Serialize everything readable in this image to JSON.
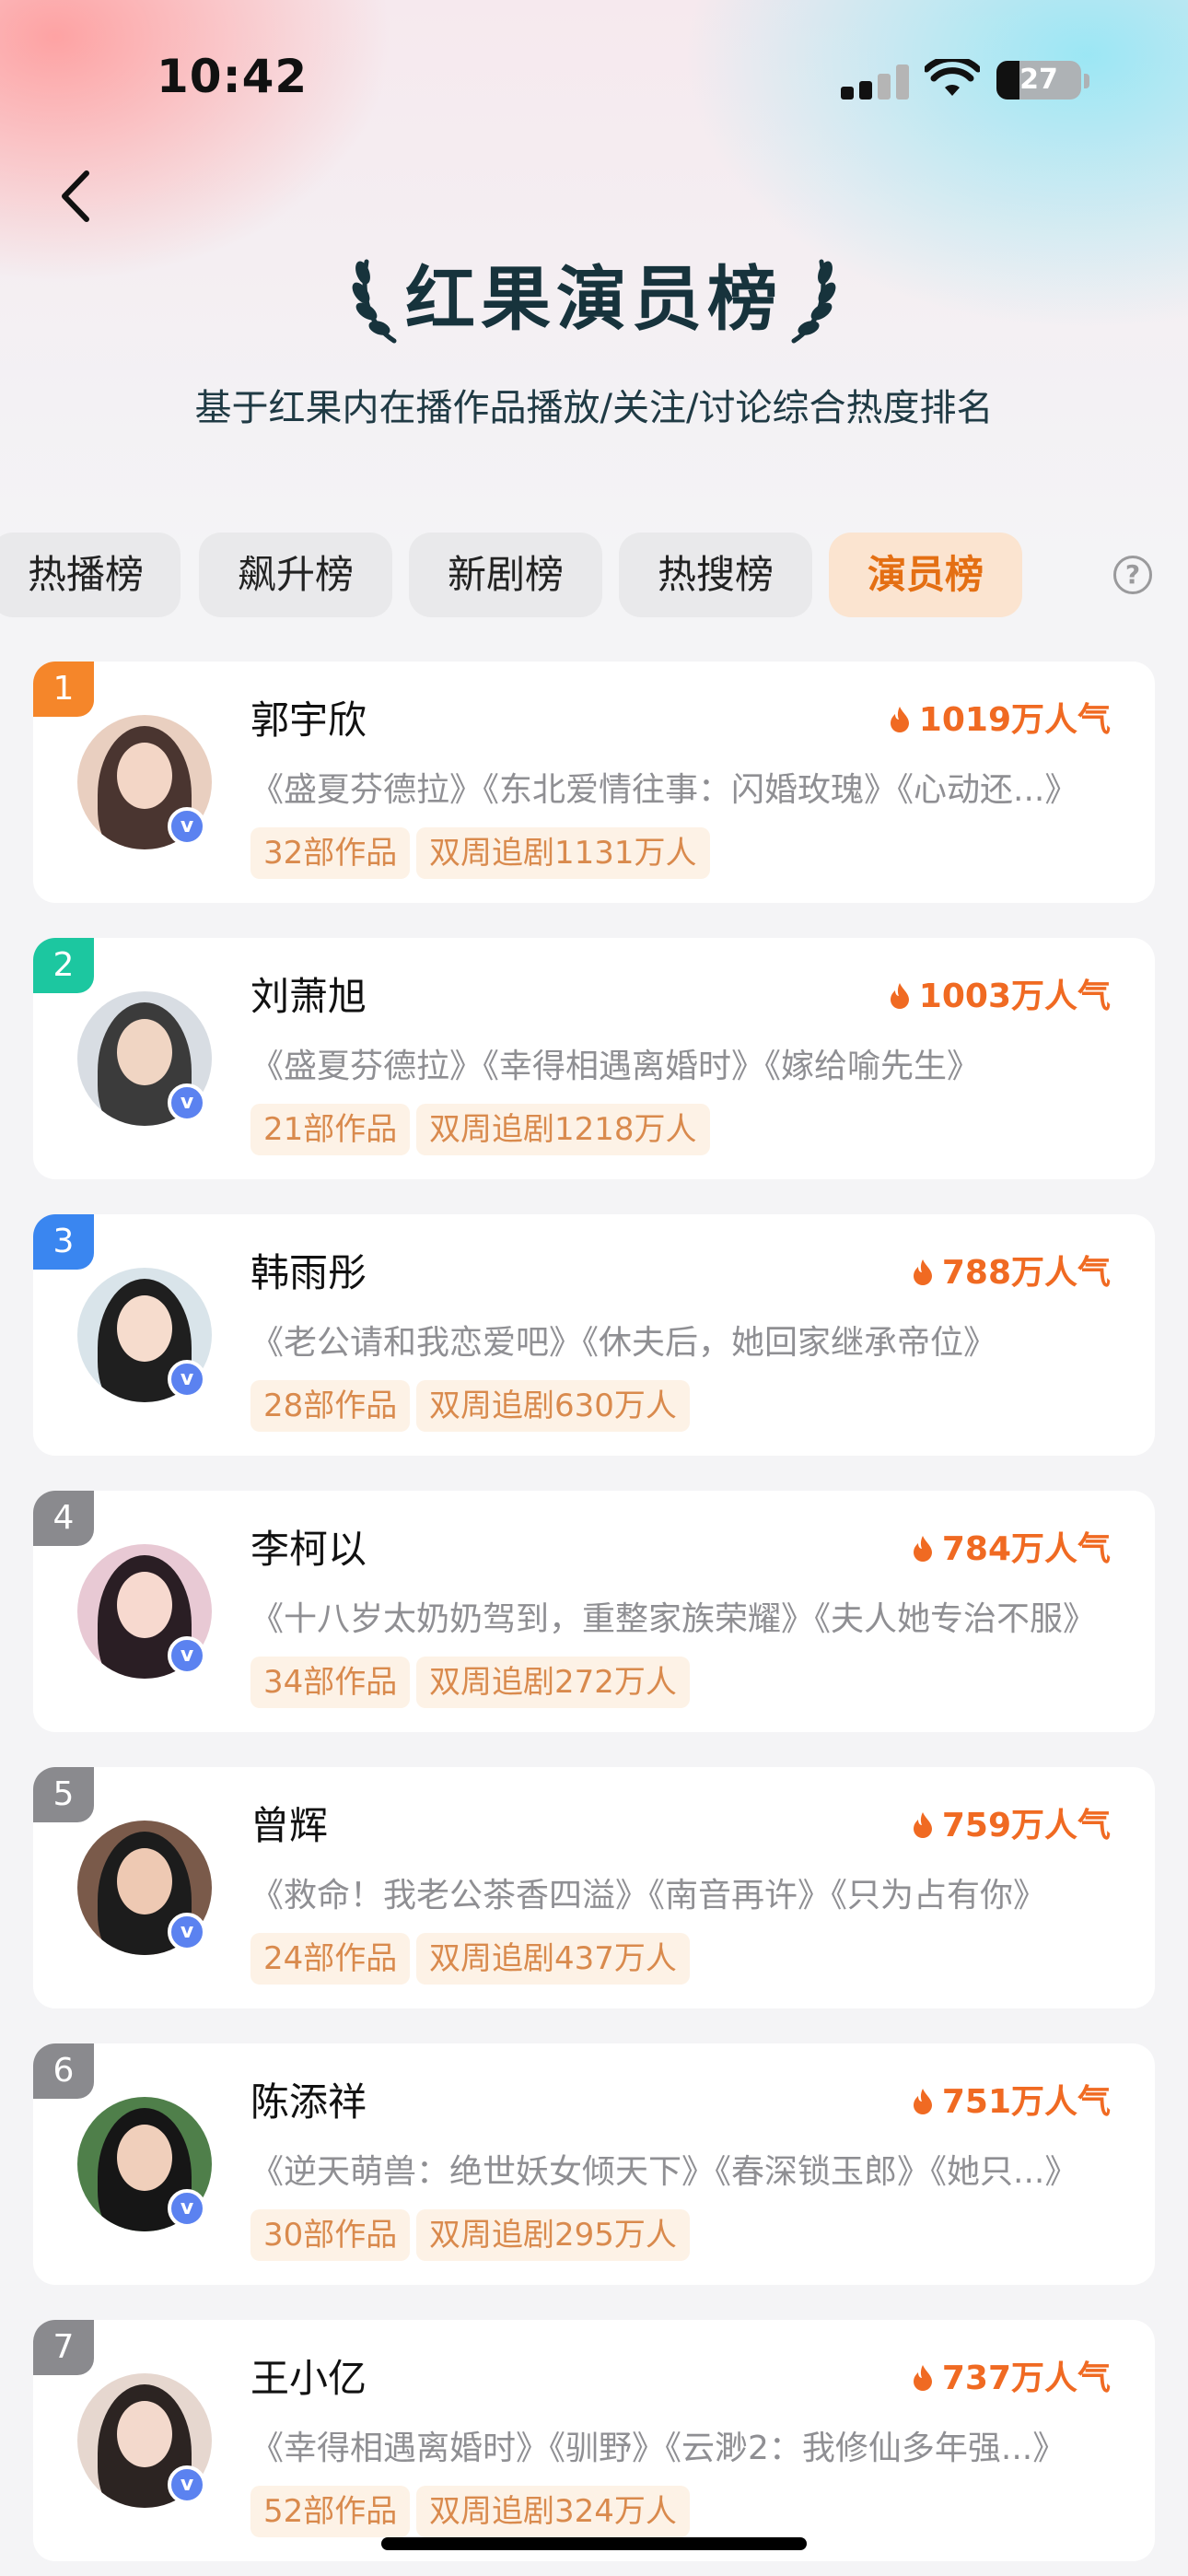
{
  "status_bar": {
    "time": "10:42",
    "battery": "27",
    "battery_level": 0.27
  },
  "header": {
    "title": "红果演员榜",
    "subtitle": "基于红果内在播作品播放/关注/讨论综合热度排名"
  },
  "tabs": [
    {
      "label": "热播榜",
      "active": false
    },
    {
      "label": "飙升榜",
      "active": false
    },
    {
      "label": "新剧榜",
      "active": false
    },
    {
      "label": "热搜榜",
      "active": false
    },
    {
      "label": "演员榜",
      "active": true
    }
  ],
  "colors": {
    "accent": "#f06a22",
    "rank_1": "#f5862a",
    "rank_2": "#1cc7a0",
    "rank_3": "#3a86f0",
    "rank_other": "#8a8a8e",
    "verified": "#5b82f0"
  },
  "ranking": [
    {
      "rank": "1",
      "name": "郭宇欣",
      "heat": "1019万人气",
      "works": "《盛夏芬德拉》《东北爱情往事：闪婚玫瑰》《心动还...》",
      "count": "32部作品",
      "chase": "双周追剧1131万人"
    },
    {
      "rank": "2",
      "name": "刘萧旭",
      "heat": "1003万人气",
      "works": "《盛夏芬德拉》《幸得相遇离婚时》《嫁给喻先生》",
      "count": "21部作品",
      "chase": "双周追剧1218万人"
    },
    {
      "rank": "3",
      "name": "韩雨彤",
      "heat": "788万人气",
      "works": "《老公请和我恋爱吧》《休夫后，她回家继承帝位》",
      "count": "28部作品",
      "chase": "双周追剧630万人"
    },
    {
      "rank": "4",
      "name": "李柯以",
      "heat": "784万人气",
      "works": "《十八岁太奶奶驾到，重整家族荣耀》《夫人她专治不服》",
      "count": "34部作品",
      "chase": "双周追剧272万人"
    },
    {
      "rank": "5",
      "name": "曾辉",
      "heat": "759万人气",
      "works": "《救命！我老公茶香四溢》《南音再许》《只为占有你》",
      "count": "24部作品",
      "chase": "双周追剧437万人"
    },
    {
      "rank": "6",
      "name": "陈添祥",
      "heat": "751万人气",
      "works": "《逆天萌兽：绝世妖女倾天下》《春深锁玉郎》《她只...》",
      "count": "30部作品",
      "chase": "双周追剧295万人"
    },
    {
      "rank": "7",
      "name": "王小亿",
      "heat": "737万人气",
      "works": "《幸得相遇离婚时》《驯野》《云渺2：我修仙多年强...》",
      "count": "52部作品",
      "chase": "双周追剧324万人"
    }
  ]
}
